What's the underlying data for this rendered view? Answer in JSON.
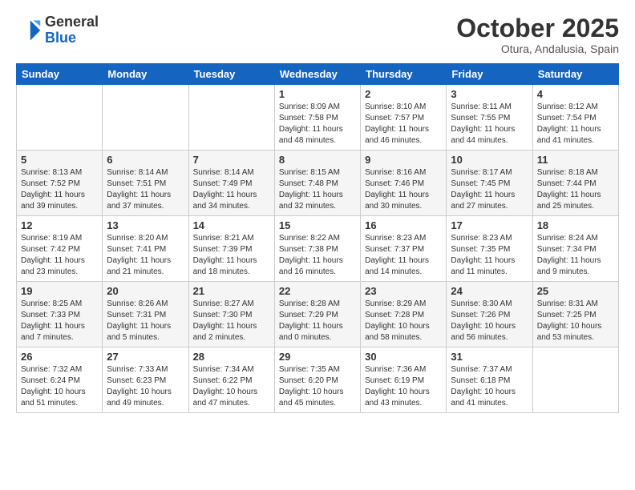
{
  "header": {
    "logo_general": "General",
    "logo_blue": "Blue",
    "month_title": "October 2025",
    "location": "Otura, Andalusia, Spain"
  },
  "weekdays": [
    "Sunday",
    "Monday",
    "Tuesday",
    "Wednesday",
    "Thursday",
    "Friday",
    "Saturday"
  ],
  "weeks": [
    [
      {
        "day": "",
        "info": ""
      },
      {
        "day": "",
        "info": ""
      },
      {
        "day": "",
        "info": ""
      },
      {
        "day": "1",
        "info": "Sunrise: 8:09 AM\nSunset: 7:58 PM\nDaylight: 11 hours\nand 48 minutes."
      },
      {
        "day": "2",
        "info": "Sunrise: 8:10 AM\nSunset: 7:57 PM\nDaylight: 11 hours\nand 46 minutes."
      },
      {
        "day": "3",
        "info": "Sunrise: 8:11 AM\nSunset: 7:55 PM\nDaylight: 11 hours\nand 44 minutes."
      },
      {
        "day": "4",
        "info": "Sunrise: 8:12 AM\nSunset: 7:54 PM\nDaylight: 11 hours\nand 41 minutes."
      }
    ],
    [
      {
        "day": "5",
        "info": "Sunrise: 8:13 AM\nSunset: 7:52 PM\nDaylight: 11 hours\nand 39 minutes."
      },
      {
        "day": "6",
        "info": "Sunrise: 8:14 AM\nSunset: 7:51 PM\nDaylight: 11 hours\nand 37 minutes."
      },
      {
        "day": "7",
        "info": "Sunrise: 8:14 AM\nSunset: 7:49 PM\nDaylight: 11 hours\nand 34 minutes."
      },
      {
        "day": "8",
        "info": "Sunrise: 8:15 AM\nSunset: 7:48 PM\nDaylight: 11 hours\nand 32 minutes."
      },
      {
        "day": "9",
        "info": "Sunrise: 8:16 AM\nSunset: 7:46 PM\nDaylight: 11 hours\nand 30 minutes."
      },
      {
        "day": "10",
        "info": "Sunrise: 8:17 AM\nSunset: 7:45 PM\nDaylight: 11 hours\nand 27 minutes."
      },
      {
        "day": "11",
        "info": "Sunrise: 8:18 AM\nSunset: 7:44 PM\nDaylight: 11 hours\nand 25 minutes."
      }
    ],
    [
      {
        "day": "12",
        "info": "Sunrise: 8:19 AM\nSunset: 7:42 PM\nDaylight: 11 hours\nand 23 minutes."
      },
      {
        "day": "13",
        "info": "Sunrise: 8:20 AM\nSunset: 7:41 PM\nDaylight: 11 hours\nand 21 minutes."
      },
      {
        "day": "14",
        "info": "Sunrise: 8:21 AM\nSunset: 7:39 PM\nDaylight: 11 hours\nand 18 minutes."
      },
      {
        "day": "15",
        "info": "Sunrise: 8:22 AM\nSunset: 7:38 PM\nDaylight: 11 hours\nand 16 minutes."
      },
      {
        "day": "16",
        "info": "Sunrise: 8:23 AM\nSunset: 7:37 PM\nDaylight: 11 hours\nand 14 minutes."
      },
      {
        "day": "17",
        "info": "Sunrise: 8:23 AM\nSunset: 7:35 PM\nDaylight: 11 hours\nand 11 minutes."
      },
      {
        "day": "18",
        "info": "Sunrise: 8:24 AM\nSunset: 7:34 PM\nDaylight: 11 hours\nand 9 minutes."
      }
    ],
    [
      {
        "day": "19",
        "info": "Sunrise: 8:25 AM\nSunset: 7:33 PM\nDaylight: 11 hours\nand 7 minutes."
      },
      {
        "day": "20",
        "info": "Sunrise: 8:26 AM\nSunset: 7:31 PM\nDaylight: 11 hours\nand 5 minutes."
      },
      {
        "day": "21",
        "info": "Sunrise: 8:27 AM\nSunset: 7:30 PM\nDaylight: 11 hours\nand 2 minutes."
      },
      {
        "day": "22",
        "info": "Sunrise: 8:28 AM\nSunset: 7:29 PM\nDaylight: 11 hours\nand 0 minutes."
      },
      {
        "day": "23",
        "info": "Sunrise: 8:29 AM\nSunset: 7:28 PM\nDaylight: 10 hours\nand 58 minutes."
      },
      {
        "day": "24",
        "info": "Sunrise: 8:30 AM\nSunset: 7:26 PM\nDaylight: 10 hours\nand 56 minutes."
      },
      {
        "day": "25",
        "info": "Sunrise: 8:31 AM\nSunset: 7:25 PM\nDaylight: 10 hours\nand 53 minutes."
      }
    ],
    [
      {
        "day": "26",
        "info": "Sunrise: 7:32 AM\nSunset: 6:24 PM\nDaylight: 10 hours\nand 51 minutes."
      },
      {
        "day": "27",
        "info": "Sunrise: 7:33 AM\nSunset: 6:23 PM\nDaylight: 10 hours\nand 49 minutes."
      },
      {
        "day": "28",
        "info": "Sunrise: 7:34 AM\nSunset: 6:22 PM\nDaylight: 10 hours\nand 47 minutes."
      },
      {
        "day": "29",
        "info": "Sunrise: 7:35 AM\nSunset: 6:20 PM\nDaylight: 10 hours\nand 45 minutes."
      },
      {
        "day": "30",
        "info": "Sunrise: 7:36 AM\nSunset: 6:19 PM\nDaylight: 10 hours\nand 43 minutes."
      },
      {
        "day": "31",
        "info": "Sunrise: 7:37 AM\nSunset: 6:18 PM\nDaylight: 10 hours\nand 41 minutes."
      },
      {
        "day": "",
        "info": ""
      }
    ]
  ]
}
